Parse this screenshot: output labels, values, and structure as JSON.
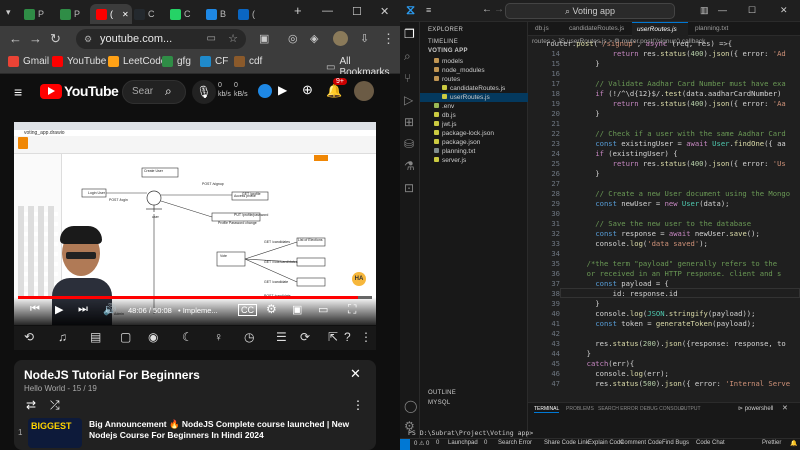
{
  "browser": {
    "tabs": [
      {
        "label": "P",
        "icon": "gfg-icon"
      },
      {
        "label": "P",
        "icon": "gfg-icon"
      },
      {
        "label": "(",
        "icon": "youtube-icon"
      },
      {
        "label": "C",
        "icon": "github-icon"
      },
      {
        "label": "C",
        "icon": "whatsapp-icon"
      },
      {
        "label": "B",
        "icon": "blog-icon"
      },
      {
        "label": "(",
        "icon": "linkedin-icon"
      }
    ],
    "url": "youtube.com...",
    "bookmarks": [
      {
        "label": "Gmail",
        "icon": "gmail-icon"
      },
      {
        "label": "YouTube",
        "icon": "youtube-icon"
      },
      {
        "label": "LeetCode",
        "icon": "leetcode-icon"
      },
      {
        "label": "gfg",
        "icon": "gfg-icon"
      },
      {
        "label": "CF",
        "icon": "codeforces-icon"
      },
      {
        "label": "cdf",
        "icon": "cdf-icon"
      }
    ],
    "all_bookmarks": "All Bookmarks"
  },
  "youtube": {
    "logo": "YouTube",
    "country": "IN",
    "search_placeholder": "Sear",
    "stat_top": "0",
    "stat_mid": "0",
    "stat_unit1": "kb/s",
    "stat_unit2": "kB/s",
    "notifications": "9+",
    "video": {
      "time": "48:06 / 50:08",
      "chapter": "• Impleme...",
      "progress": 0.96,
      "diagram": {
        "file": "voting_app.drawio",
        "labels": [
          "Create User",
          "POST /signup",
          "POST /login",
          "GET /profile",
          "Access profile",
          "PUT /profile/password",
          "Profile Password change",
          "Login User",
          "user",
          "GET /candidates",
          "GET /vote/candidates",
          "GET /candidate",
          "POST /candidate",
          "List of Elections",
          "Vote",
          "Admin"
        ],
        "channel_mark": "HA"
      }
    },
    "playlist": {
      "title": "NodeJS Tutorial For Beginners",
      "channel": "Hello World",
      "position": "15 / 19",
      "item_index": "1",
      "item_thumb": "BIGGEST",
      "item_title": "Big Announcement 🔥 NodeJS Complete course launched | New Nodejs Course For Beginners In Hindi 2024"
    }
  },
  "vscode": {
    "title": "Voting app",
    "explorer_label": "EXPLORER",
    "timeline_label": "TIMELINE",
    "project_label": "VOTING APP",
    "tree": [
      {
        "name": "models",
        "type": "folder",
        "depth": 1,
        "selected": false
      },
      {
        "name": "node_modules",
        "type": "folder",
        "depth": 1,
        "selected": false
      },
      {
        "name": "routes",
        "type": "folder",
        "depth": 1,
        "selected": false
      },
      {
        "name": "candidateRoutes.js",
        "type": "js",
        "depth": 2,
        "selected": false
      },
      {
        "name": "userRoutes.js",
        "type": "js",
        "depth": 2,
        "selected": true
      },
      {
        "name": ".env",
        "type": "env",
        "depth": 1,
        "selected": false
      },
      {
        "name": "db.js",
        "type": "js",
        "depth": 1,
        "selected": false
      },
      {
        "name": "jwt.js",
        "type": "js",
        "depth": 1,
        "selected": false
      },
      {
        "name": "package-lock.json",
        "type": "json",
        "depth": 1,
        "selected": false
      },
      {
        "name": "package.json",
        "type": "json",
        "depth": 1,
        "selected": false
      },
      {
        "name": "planning.txt",
        "type": "txt",
        "depth": 1,
        "selected": false
      },
      {
        "name": "server.js",
        "type": "js",
        "depth": 1,
        "selected": false
      }
    ],
    "outline_label": "OUTLINE",
    "mysql_label": "MYSQL",
    "editor_tabs": [
      {
        "label": "db.js",
        "active": false
      },
      {
        "label": "candidateRoutes.js",
        "active": false
      },
      {
        "label": "userRoutes.js",
        "active": true
      },
      {
        "label": "planning.txt",
        "active": false
      }
    ],
    "breadcrumb": "routes > JS userRoutes.js > ⚙ router.post('/signup') callback",
    "code_lines": [
      {
        "n": "",
        "text": "router.post('/signup', async (req, res) =>{"
      },
      {
        "n": "14",
        "text": "        return res.status(400).json({ error: 'Ad"
      },
      {
        "n": "15",
        "text": "    }"
      },
      {
        "n": "16",
        "text": ""
      },
      {
        "n": "17",
        "text": "    // Validate Aadhar Card Number must have exa"
      },
      {
        "n": "18",
        "text": "    if (!/^\\d{12}$/.test(data.aadharCardNumber)"
      },
      {
        "n": "19",
        "text": "        return res.status(400).json({ error: 'Aa"
      },
      {
        "n": "20",
        "text": "    }"
      },
      {
        "n": "21",
        "text": ""
      },
      {
        "n": "22",
        "text": "    // Check if a user with the same Aadhar Card"
      },
      {
        "n": "23",
        "text": "    const existingUser = await User.findOne({ aa"
      },
      {
        "n": "24",
        "text": "    if (existingUser) {"
      },
      {
        "n": "25",
        "text": "        return res.status(400).json({ error: 'Us"
      },
      {
        "n": "26",
        "text": "    }"
      },
      {
        "n": "27",
        "text": ""
      },
      {
        "n": "28",
        "text": "    // Create a new User document using the Mongo"
      },
      {
        "n": "29",
        "text": "    const newUser = new User(data);"
      },
      {
        "n": "30",
        "text": ""
      },
      {
        "n": "31",
        "text": "    // Save the new user to the database"
      },
      {
        "n": "32",
        "text": "    const response = await newUser.save();"
      },
      {
        "n": "33",
        "text": "    console.log('data saved');"
      },
      {
        "n": "34",
        "text": ""
      },
      {
        "n": "35",
        "text": "  /*the term \"payload\" generally refers to the"
      },
      {
        "n": "36",
        "text": "  or received in an HTTP response. client and s"
      },
      {
        "n": "37",
        "text": "    const payload = {"
      },
      {
        "n": "38",
        "text": "        id: response.id"
      },
      {
        "n": "39",
        "text": "    }"
      },
      {
        "n": "40",
        "text": "    console.log(JSON.stringify(payload));"
      },
      {
        "n": "41",
        "text": "    const token = generateToken(payload);"
      },
      {
        "n": "42",
        "text": ""
      },
      {
        "n": "43",
        "text": "    res.status(200).json({response: response, to"
      },
      {
        "n": "44",
        "text": "  }"
      },
      {
        "n": "45",
        "text": "  catch(err){"
      },
      {
        "n": "46",
        "text": "    console.log(err);"
      },
      {
        "n": "47",
        "text": "    res.status(500).json({ error: 'Internal Serve"
      }
    ],
    "terminal": {
      "tabs": [
        "TERMINAL",
        "PROBLEMS",
        "SEARCH ERROR",
        "DEBUG CONSOLE",
        "OUTPUT"
      ],
      "shell": "powershell",
      "prompt": "PS D:\\Subrat\\Project\\Voting app>"
    },
    "status": {
      "left": [
        "0 ⚠ 0",
        "0",
        "Launchpad",
        "0",
        "Search Error",
        "Share Code Link",
        "Explain Code",
        "Comment Code",
        "Find Bugs",
        "Code Chat"
      ],
      "right": "Prettier"
    }
  },
  "colors": {
    "youtube_red": "#ff0000",
    "vscode_accent": "#0078d4",
    "selection": "#04395e"
  }
}
